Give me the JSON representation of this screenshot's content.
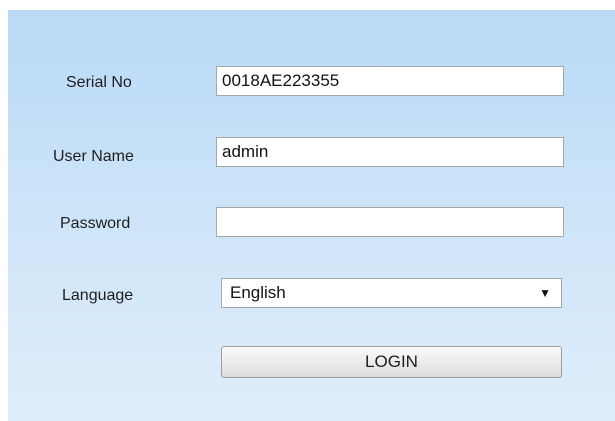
{
  "form": {
    "serial": {
      "label": "Serial No",
      "value": "0018AE223355"
    },
    "username": {
      "label": "User Name",
      "value": "admin"
    },
    "password": {
      "label": "Password",
      "value": ""
    },
    "language": {
      "label": "Language",
      "selected": "English",
      "arrow_icon": "triangle-down-icon"
    },
    "login_label": "LOGIN"
  },
  "colors": {
    "panel_top": "#b9daf6",
    "panel_bottom": "#dfeefb"
  }
}
